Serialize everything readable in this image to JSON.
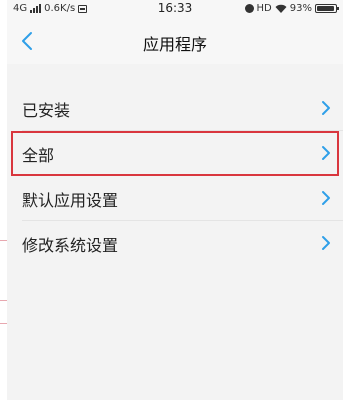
{
  "status_bar": {
    "network": "4G",
    "speed": "0.6K/s",
    "time": "16:33",
    "hd": "HD",
    "battery": "93%",
    "battery_level": 0.93
  },
  "header": {
    "title": "应用程序"
  },
  "menu": {
    "items": [
      {
        "label": "已安装"
      },
      {
        "label": "全部",
        "highlighted": true
      },
      {
        "label": "默认应用设置"
      },
      {
        "label": "修改系统设置"
      }
    ]
  },
  "colors": {
    "accent": "#2f9fe8",
    "highlight_border": "#d9363e",
    "background": "#f3f3f3"
  }
}
